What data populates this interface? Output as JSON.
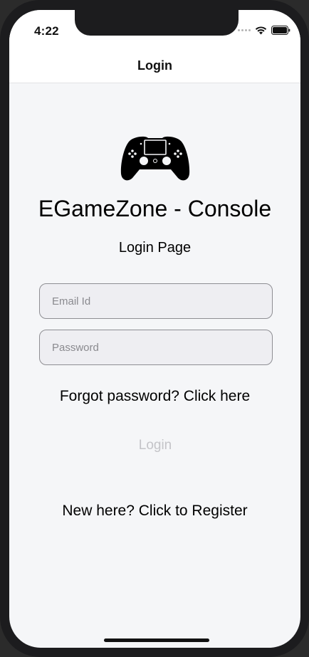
{
  "status_bar": {
    "time": "4:22",
    "icons": [
      "signal-dots-icon",
      "wifi-icon",
      "battery-icon"
    ]
  },
  "nav": {
    "title": "Login"
  },
  "main": {
    "logo_icon": "gamepad-icon",
    "app_title": "EGameZone - Console",
    "subtitle": "Login Page",
    "email": {
      "placeholder": "Email Id",
      "value": ""
    },
    "password": {
      "placeholder": "Password",
      "value": ""
    },
    "forgot_label": "Forgot password? Click here",
    "login_label": "Login",
    "register_label": "New here? Click to Register"
  },
  "colors": {
    "background": "#f5f6f8",
    "input_background": "#eeeef2",
    "input_border": "#8e8e93",
    "disabled_text": "#c4c4c8"
  }
}
